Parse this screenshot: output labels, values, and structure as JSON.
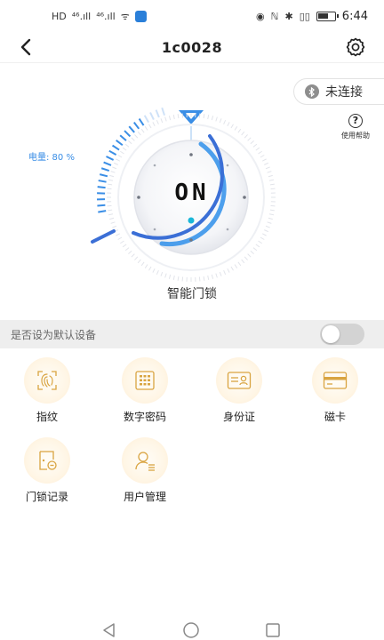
{
  "status_bar": {
    "left_glyphs": [
      "HD",
      "⁴⁶.ıll",
      "⁴⁶.ıll",
      "ᯤ"
    ],
    "right_glyphs": [
      "◉",
      "ℕ",
      "✱",
      "▯▯"
    ],
    "battery_level": 0.65,
    "time": "6:44"
  },
  "nav": {
    "title": "1c0028"
  },
  "connection": {
    "status": "未连接"
  },
  "help": {
    "icon_glyph": "?",
    "label": "使用帮助"
  },
  "lock": {
    "battery_label": "电量: 80 %",
    "battery_percent": 80,
    "state": "ON",
    "device_name": "智能门锁",
    "accent_color": "#2f8fea"
  },
  "default_device": {
    "label": "是否设为默认设备",
    "enabled": false
  },
  "features": [
    {
      "label": "指纹",
      "icon": "fingerprint-icon"
    },
    {
      "label": "数字密码",
      "icon": "keypad-icon"
    },
    {
      "label": "身份证",
      "icon": "id-card-icon"
    },
    {
      "label": "磁卡",
      "icon": "magnetic-card-icon"
    },
    {
      "label": "门锁记录",
      "icon": "door-record-icon"
    },
    {
      "label": "用户管理",
      "icon": "user-management-icon"
    }
  ],
  "system_nav": [
    "back-button",
    "home-button",
    "recents-button"
  ]
}
